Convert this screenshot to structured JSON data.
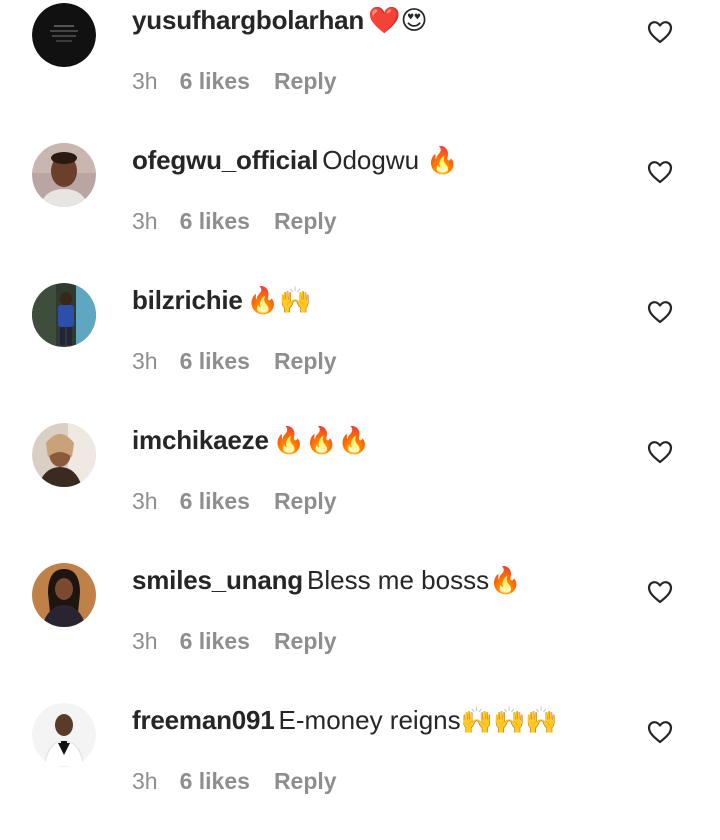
{
  "colors": {
    "text": "#262626",
    "meta": "#8e8e8e",
    "background": "#ffffff"
  },
  "comments": [
    {
      "username": "yusufhargbolarhan",
      "text": "❤️😍",
      "time": "3h",
      "likes": "6 likes",
      "reply": "Reply",
      "avatar_icon": "dark-avatar",
      "like_icon": "heart-outline-icon"
    },
    {
      "username": "ofegwu_official",
      "text": "Odogwu 🔥",
      "time": "3h",
      "likes": "6 likes",
      "reply": "Reply",
      "avatar_icon": "profile-photo",
      "like_icon": "heart-outline-icon"
    },
    {
      "username": "bilzrichie",
      "text": "🔥🙌",
      "time": "3h",
      "likes": "6 likes",
      "reply": "Reply",
      "avatar_icon": "profile-photo",
      "like_icon": "heart-outline-icon"
    },
    {
      "username": "imchikaeze",
      "text": "🔥🔥🔥",
      "time": "3h",
      "likes": "6 likes",
      "reply": "Reply",
      "avatar_icon": "profile-photo",
      "like_icon": "heart-outline-icon"
    },
    {
      "username": "smiles_unang",
      "text": "Bless me bosss🔥",
      "time": "3h",
      "likes": "6 likes",
      "reply": "Reply",
      "avatar_icon": "profile-photo",
      "like_icon": "heart-outline-icon"
    },
    {
      "username": "freeman091",
      "text": "E-money reigns🙌🙌🙌",
      "time": "3h",
      "likes": "6 likes",
      "reply": "Reply",
      "avatar_icon": "profile-photo",
      "like_icon": "heart-outline-icon"
    }
  ]
}
